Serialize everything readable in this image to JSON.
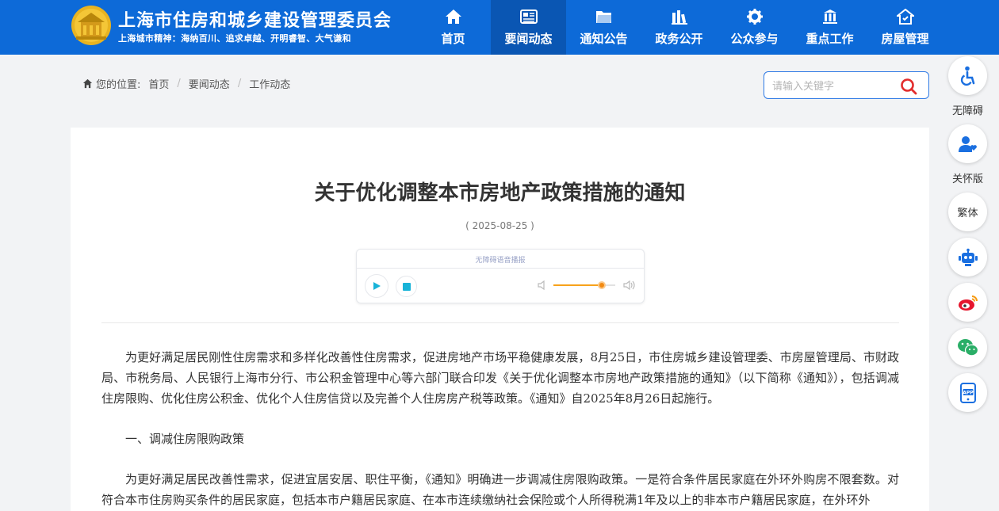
{
  "header": {
    "site_title": "上海市住房和城乡建设管理委员会",
    "site_slogan": "上海城市精神：海纳百川、追求卓越、开明睿智、大气谦和",
    "brand_color": "#0d6ad8",
    "active_color": "#0a56b3",
    "nav": [
      {
        "label": "首页",
        "icon": "home-icon",
        "active": false
      },
      {
        "label": "要闻动态",
        "icon": "news-icon",
        "active": true
      },
      {
        "label": "通知公告",
        "icon": "folder-icon",
        "active": false
      },
      {
        "label": "政务公开",
        "icon": "books-icon",
        "active": false
      },
      {
        "label": "公众参与",
        "icon": "gear-icon",
        "active": false
      },
      {
        "label": "重点工作",
        "icon": "building-icon",
        "active": false
      },
      {
        "label": "房屋管理",
        "icon": "house-icon",
        "active": false
      }
    ]
  },
  "breadcrumb": {
    "prefix": "您的位置:",
    "items": [
      "首页",
      "要闻动态",
      "工作动态"
    ],
    "separator": "/"
  },
  "search": {
    "placeholder": "请输入关键字"
  },
  "article": {
    "title": "关于优化调整本市房地产政策措施的通知",
    "date": "( 2025-08-25 )",
    "player": {
      "title": "无障碍语音播报",
      "volume_percent": 78
    },
    "paragraphs": [
      "为更好满足居民刚性住房需求和多样化改善性住房需求，促进房地产市场平稳健康发展，8月25日，市住房城乡建设管理委、市房屋管理局、市财政局、市税务局、人民银行上海市分行、市公积金管理中心等六部门联合印发《关于优化调整本市房地产政策措施的通知》（以下简称《通知》），包括调减住房限购、优化住房公积金、优化个人住房信贷以及完善个人住房房产税等政策。《通知》自2025年8月26日起施行。",
      "一、调减住房限购政策",
      "为更好满足居民改善性需求，促进宜居安居、职住平衡，《通知》明确进一步调减住房限购政策。一是符合条件居民家庭在外环外购房不限套数。对符合本市住房购买条件的居民家庭，包括本市户籍居民家庭、在本市连续缴纳社会保险或个人所得税满1年及以上的非本市户籍居民家庭，在外环外"
    ]
  },
  "sidebar": {
    "accessibility_label": "无障碍",
    "care_label": "关怀版",
    "traditional_label": "繁体",
    "icons": [
      "accessibility-icon",
      "care-mode-icon",
      "traditional-chinese-button",
      "robot-icon",
      "weibo-icon",
      "wechat-icon",
      "app-icon"
    ]
  },
  "colors": {
    "page_bg": "#f2f3f5",
    "accent": "#2f7ae5",
    "search_icon": "#e22d2d",
    "volume": "#f28a12"
  }
}
